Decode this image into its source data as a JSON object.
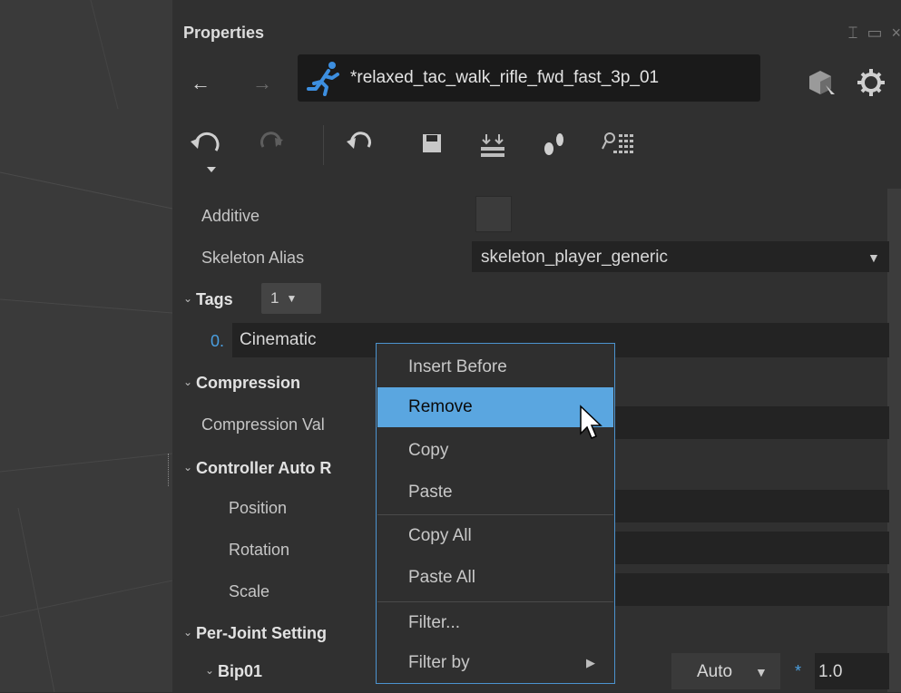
{
  "panel": {
    "title": "Properties",
    "asset_name": "*relaxed_tac_walk_rifle_fwd_fast_3p_01",
    "window_buttons": [
      "⌶",
      "▭",
      "×"
    ]
  },
  "nav": {
    "back": "←",
    "forward": "→"
  },
  "properties": {
    "additive_label": "Additive",
    "skeleton_alias_label": "Skeleton Alias",
    "skeleton_alias_value": "skeleton_player_generic",
    "tags_label": "Tags",
    "tags_count": "1",
    "tag_index": "0.",
    "tag_value": "Cinematic",
    "compression_label": "Compression",
    "compression_value_label": "Compression Val",
    "controller_label": "Controller Auto R",
    "position_label": "Position",
    "rotation_label": "Rotation",
    "scale_label": "Scale",
    "per_joint_label": "Per-Joint Setting",
    "bip_label": "Bip01",
    "bip_mode": "Auto",
    "bip_multiplier": "*",
    "bip_value": "1.0"
  },
  "context_menu": {
    "items": [
      {
        "label": "Insert Before"
      },
      {
        "label": "Remove"
      },
      {
        "label": "Copy"
      },
      {
        "label": "Paste"
      },
      {
        "label": "Copy All"
      },
      {
        "label": "Paste All"
      },
      {
        "label": "Filter..."
      },
      {
        "label": "Filter by"
      }
    ]
  },
  "colors": {
    "accent": "#5aa6e0",
    "menu_border": "#4c93cf",
    "index_blue": "#4a9fe0",
    "runner_blue": "#3d8fe0"
  }
}
